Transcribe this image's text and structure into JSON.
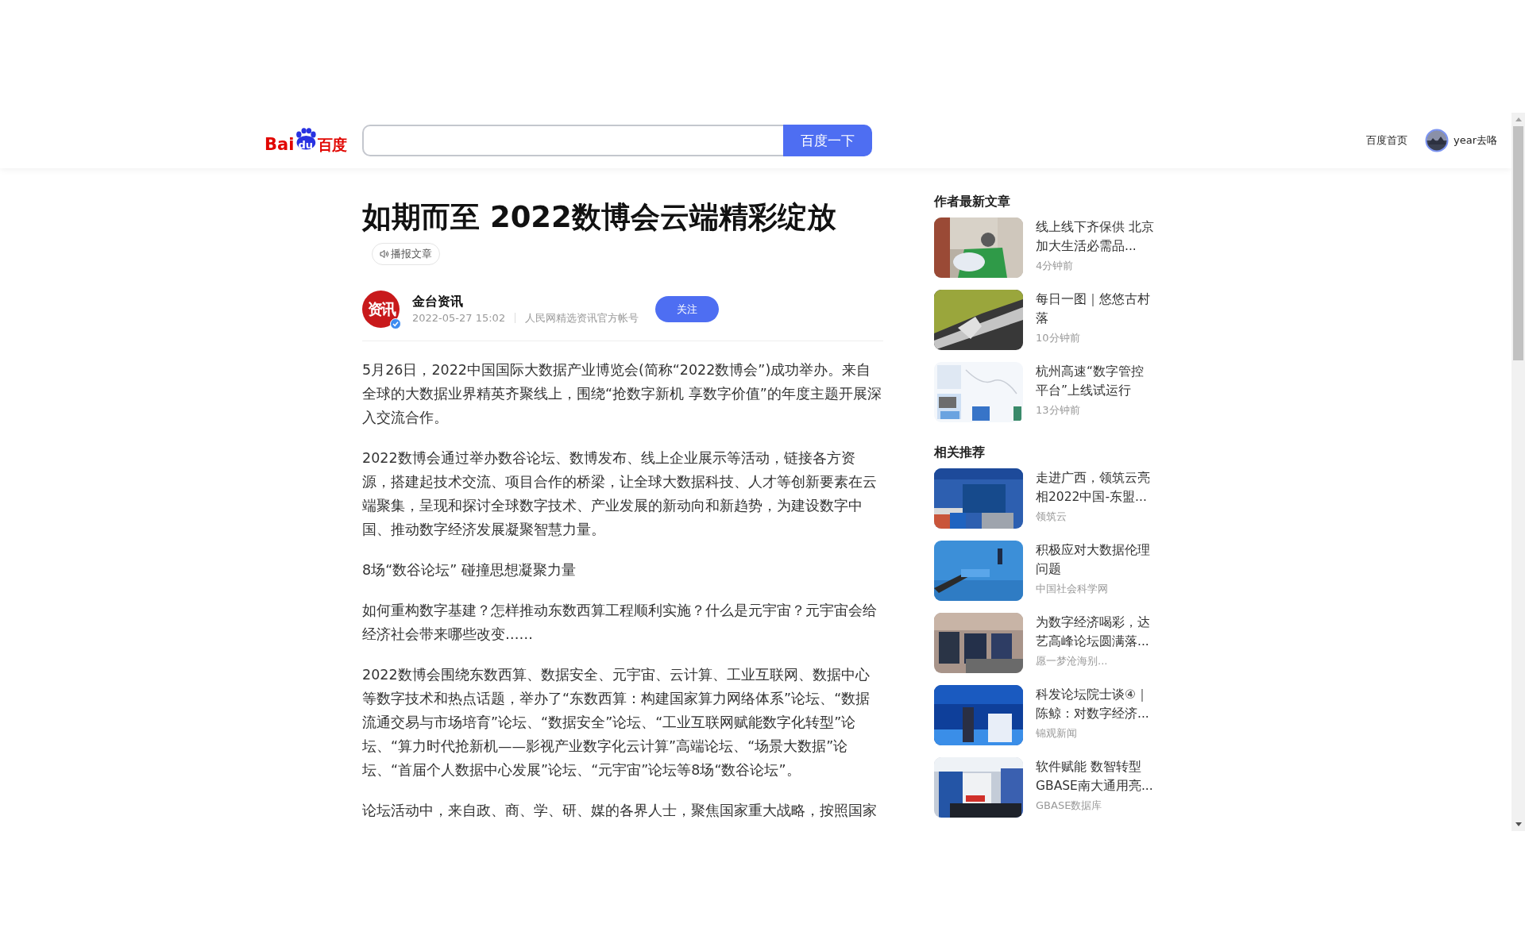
{
  "header": {
    "logo": {
      "left": "Bai",
      "paw": "du",
      "right": "百度"
    },
    "search": {
      "button": "百度一下"
    },
    "links": [
      {
        "label": "百度首页"
      }
    ],
    "user": {
      "name": "year去咯"
    }
  },
  "article": {
    "title": "如期而至 2022数博会云端精彩绽放",
    "listen_button": "播报文章",
    "author": {
      "avatar_text": "资讯",
      "verified": true,
      "name": "金台资讯",
      "date": "2022-05-27 15:02",
      "description": "人民网精选资讯官方帐号",
      "follow_button": "关注"
    },
    "paragraphs": [
      "5月26日，2022中国国际大数据产业博览会(简称“2022数博会”)成功举办。来自全球的大数据业界精英齐聚线上，围绕“抢数字新机 享数字价值”的年度主题开展深入交流合作。",
      "2022数博会通过举办数谷论坛、数博发布、线上企业展示等活动，链接各方资源，搭建起技术交流、项目合作的桥梁，让全球大数据科技、人才等创新要素在云端聚集，呈现和探讨全球数字技术、产业发展的新动向和新趋势，为建设数字中国、推动数字经济发展凝聚智慧力量。",
      "8场“数谷论坛” 碰撞思想凝聚力量",
      "如何重构数字基建？怎样推动东数西算工程顺利实施？什么是元宇宙？元宇宙会给经济社会带来哪些改变……",
      "2022数博会围绕东数西算、数据安全、元宇宙、云计算、工业互联网、数据中心等数字技术和热点话题，举办了“东数西算：构建国家算力网络体系”论坛、“数据流通交易与市场培育”论坛、“数据安全”论坛、“工业互联网赋能数字化转型”论坛、“算力时代抢新机——影视产业数字化云计算”高端论坛、“场景大数据”论坛、“首届个人数据中心发展”论坛、“元宇宙”论坛等8场“数谷论坛”。",
      "论坛活动中，来自政、商、学、研、媒的各界人士，聚焦国家重大战略，按照国家"
    ]
  },
  "sidebar": {
    "sections": [
      {
        "title": "作者最新文章",
        "items": [
          {
            "title": "线上线下齐保供 北京加大生活必需品...",
            "meta": "4分钟前"
          },
          {
            "title": "每日一图｜悠悠古村落",
            "meta": "10分钟前"
          },
          {
            "title": "杭州高速“数字管控平台”上线试运行",
            "meta": "13分钟前"
          }
        ]
      },
      {
        "title": "相关推荐",
        "items": [
          {
            "title": "走进广西，领筑云亮相2022中国-东盟...",
            "meta": "领筑云"
          },
          {
            "title": "积极应对大数据伦理问题",
            "meta": "中国社会科学网"
          },
          {
            "title": "为数字经济喝彩，达艺高峰论坛圆满落...",
            "meta": "愿一梦沧海别..."
          },
          {
            "title": "科发论坛院士谈④｜陈鲸：对数字经济...",
            "meta": "锦观新闻"
          },
          {
            "title": "软件赋能 数智转型 GBASE南大通用亮...",
            "meta": "GBASE数据库"
          }
        ]
      }
    ]
  }
}
